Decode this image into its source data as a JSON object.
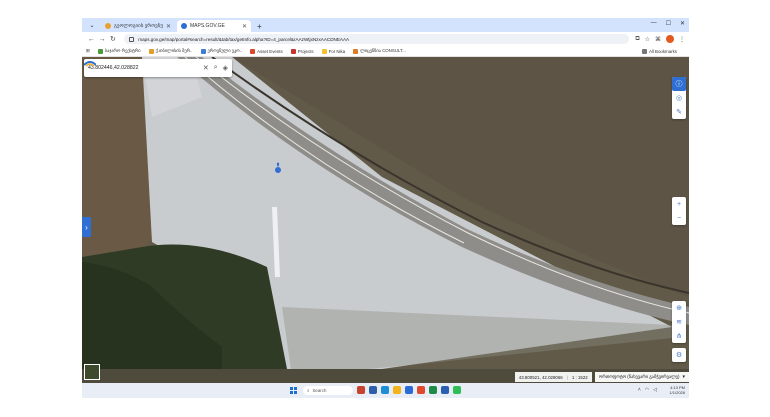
{
  "browser": {
    "tabs": [
      {
        "title": "გეოლოგიის ეროვნული სააგ...",
        "active": false
      },
      {
        "title": "MAPS.GOV.GE",
        "active": true
      }
    ],
    "new_tab": "+",
    "window_controls": {
      "minimize": "—",
      "maximize": "☐",
      "close": "✕"
    },
    "address": "maps.gov.ge/map/portal#search=result/&tab/tax/getInfo.alpha?ID=4_parcel&rAAzWtjxNzxAACDNEAAA",
    "bookmarks": [
      "საჯარო რეესტრი",
      "ქ.თბილისის მერ..",
      "ეროვნული ეკო..",
      "Asset Events",
      "Projects",
      "For Nika",
      "ლიცენზია CONSULT..."
    ],
    "all_bookmarks": "All Bookmarks"
  },
  "map": {
    "search_value": "43.802446,42.028822",
    "coordinates": "43.800521, 42.028066",
    "scale": "1 : 1522",
    "layer_select": "ორთოფოტო (ნახევარი გამჭვირვალე)",
    "icons": {
      "search": "search-icon",
      "layers": "layers-icon",
      "clear": "close-icon",
      "pin": "location-pin-icon"
    }
  },
  "taskbar": {
    "search_placeholder": "Search",
    "time": "4:13 PM",
    "date": "1/1/2026"
  }
}
